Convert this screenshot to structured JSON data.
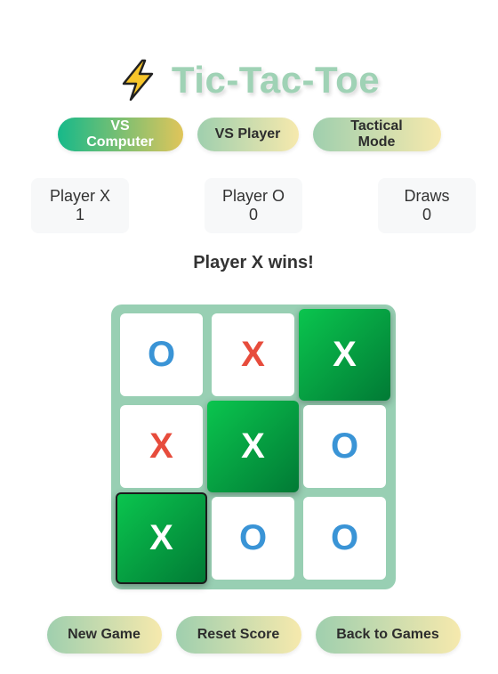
{
  "header": {
    "icon": "lightning-bolt-icon",
    "title": "Tic-Tac-Toe"
  },
  "modes": [
    {
      "label": "VS Computer",
      "active": true
    },
    {
      "label": "VS Player",
      "active": false
    },
    {
      "label": "Tactical Mode",
      "active": false
    }
  ],
  "scores": [
    {
      "label": "Player X",
      "value": "1"
    },
    {
      "label": "Player O",
      "value": "0"
    },
    {
      "label": "Draws",
      "value": "0"
    }
  ],
  "status": "Player X wins!",
  "board": {
    "cells": [
      "O",
      "X",
      "X",
      "X",
      "X",
      "O",
      "X",
      "O",
      "O"
    ],
    "winning_cells": [
      2,
      4,
      6
    ]
  },
  "actions": {
    "new_game": "New Game",
    "reset_score": "Reset Score",
    "back": "Back to Games"
  },
  "colors": {
    "x": "#e74c3c",
    "o": "#3a94d6",
    "win": "#0ac54e",
    "board": "#98cfb3",
    "title": "#9fd2b5"
  }
}
